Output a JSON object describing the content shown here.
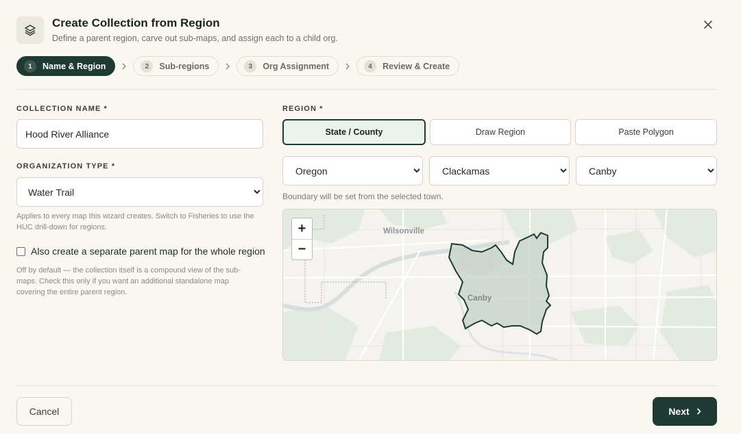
{
  "dialog": {
    "title": "Create Collection from Region",
    "subtitle": "Define a parent region, carve out sub-maps, and assign each to a child org.",
    "icon": "layers-icon",
    "close_icon": "close-icon"
  },
  "steps": [
    {
      "num": "1",
      "label": "Name & Region",
      "active": true
    },
    {
      "num": "2",
      "label": "Sub-regions"
    },
    {
      "num": "3",
      "label": "Org Assignment"
    },
    {
      "num": "4",
      "label": "Review & Create"
    }
  ],
  "collection": {
    "label": "COLLECTION NAME *",
    "value": "Hood River Alliance"
  },
  "org_type": {
    "label": "ORGANIZATION TYPE *",
    "value": "Water Trail",
    "help": "Applies to every map this wizard creates. Switch to Fisheries to use the HUC drill-down for regions."
  },
  "parent_map": {
    "label": "Also create a separate parent map for the whole region",
    "checked": false,
    "help": "Off by default — the collection itself is a compound view of the sub-maps. Check this only if you want an additional standalone map covering the entire parent region."
  },
  "region": {
    "label": "REGION *",
    "modes": [
      "State / County",
      "Draw Region",
      "Paste Polygon"
    ],
    "active_mode": "State / County",
    "state": "Oregon",
    "county": "Clackamas",
    "town": "Canby",
    "help": "Boundary will be set from the selected town."
  },
  "map": {
    "labels": {
      "city_a": "Wilsonville",
      "city_b": "Canby"
    },
    "zoom_in": "+",
    "zoom_out": "−"
  },
  "footer": {
    "cancel": "Cancel",
    "next": "Next"
  },
  "colors": {
    "accent": "#1f3a33",
    "active_mode_bg": "#e9f3ec",
    "background": "#faf7f0"
  }
}
